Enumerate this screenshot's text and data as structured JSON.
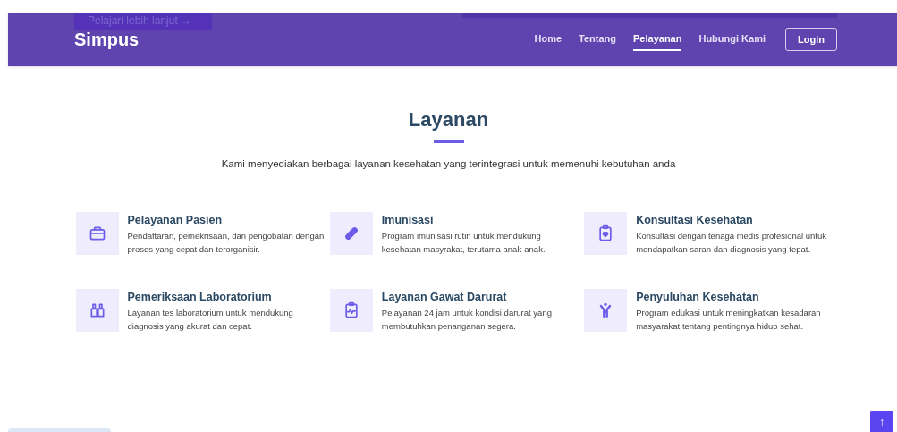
{
  "header": {
    "brand": "Simpus",
    "hero_button": "Pelajari lebih lanjut →",
    "nav": [
      {
        "label": "Home",
        "selected": false
      },
      {
        "label": "Tentang",
        "selected": false
      },
      {
        "label": "Pelayanan",
        "selected": true
      },
      {
        "label": "Hubungi Kami",
        "selected": false
      }
    ],
    "login": "Login"
  },
  "section": {
    "title": "Layanan",
    "subtitle": "Kami menyediakan berbagai layanan kesehatan yang terintegrasi untuk memenuhi kebutuhan anda",
    "services": [
      {
        "kind": "briefcase",
        "title": "Pelayanan Pasien",
        "text": "Pendaftaran, pemekrisaan, dan pengobatan dengan proses yang cepat dan terorganisir."
      },
      {
        "kind": "capsule",
        "title": "Imunisasi",
        "text": "Program imunisasi rutin untuk mendukung kesehatan masyrakat, terutama anak-anak."
      },
      {
        "kind": "clipboard-heart",
        "title": "Konsultasi Kesehatan",
        "text": "Konsultasi dengan tenaga medis profesional untuk mendapatkan saran dan diagnosis yang tepat."
      },
      {
        "kind": "binoculars",
        "title": "Pemeriksaan Laboratorium",
        "text": "Layanan tes laboratorium untuk mendukung diagnosis yang akurat dan cepat."
      },
      {
        "kind": "clipboard-pulse",
        "title": "Layanan Gawat Darurat",
        "text": "Pelayanan 24 jam untuk kondisi darurat yang membutuhkan penanganan segera."
      },
      {
        "kind": "person",
        "title": "Penyuluhan Kesehatan",
        "text": "Program edukasi untuk meningkatkan kesadaran masyarakat tentang pentingnya hidup sehat."
      }
    ]
  },
  "back_to_top": "↑"
}
